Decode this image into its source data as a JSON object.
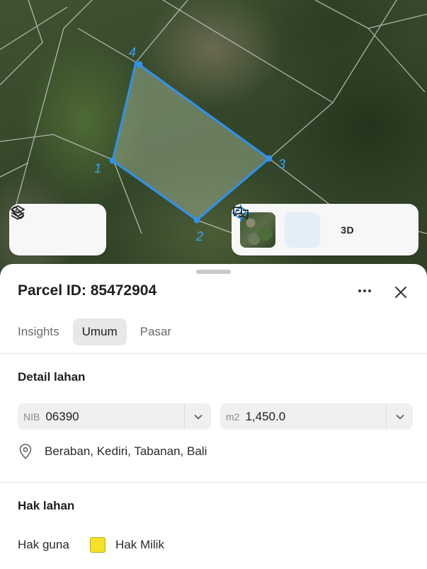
{
  "map": {
    "vertex_labels": [
      "1",
      "2",
      "3",
      "4"
    ],
    "parcel_color": "#2f93ee",
    "layers_icon": "layers-icon",
    "measure_icon": "ruler-icon",
    "locate_icon": "crosshair-icon",
    "view_3d_label": "3D",
    "feedback_icon": "chat-feedback-icon"
  },
  "sheet": {
    "title": "Parcel ID: 85472904",
    "tabs": [
      {
        "label": "Insights",
        "active": false
      },
      {
        "label": "Umum",
        "active": true
      },
      {
        "label": "Pasar",
        "active": false
      }
    ],
    "land_detail": {
      "heading": "Detail lahan",
      "nib_prefix": "NIB",
      "nib_value": "06390",
      "area_prefix": "m2",
      "area_value": "1,450.0",
      "location": "Beraban, Kediri, Tabanan, Bali"
    },
    "land_rights": {
      "heading": "Hak lahan",
      "type_label": "Hak guna",
      "type_value": "Hak Milik",
      "type_color": "#f5e12a"
    }
  }
}
